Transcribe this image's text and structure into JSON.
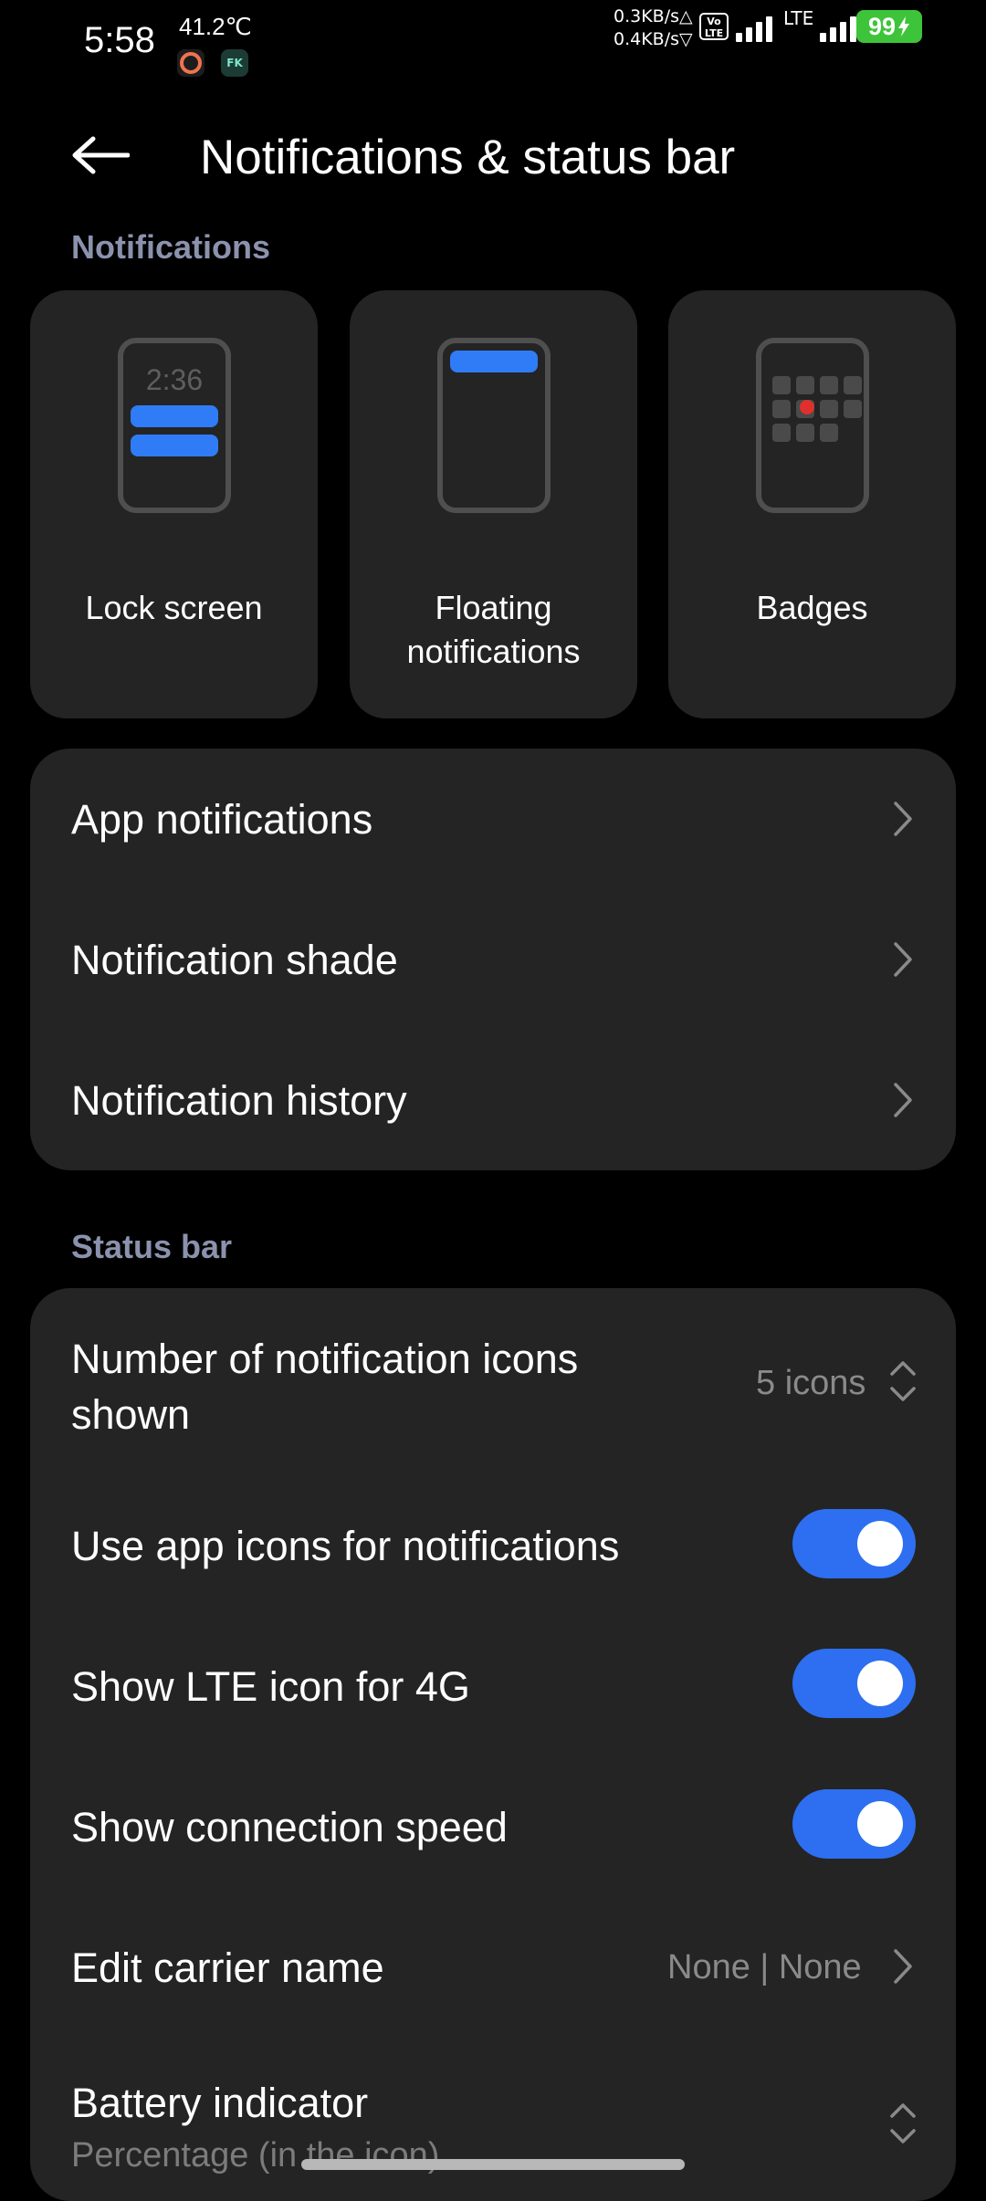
{
  "status_bar": {
    "time": "5:58",
    "temperature": "41.2℃",
    "speed_up": "0.3KB/s",
    "speed_down": "0.4KB/s",
    "volte_line1": "Vo",
    "volte_line2": "LTE",
    "network": "LTE",
    "battery": "99",
    "battery_color": "#3ec43a",
    "icons": [
      "ring-app-icon",
      "fk-app-icon",
      "signal-icon",
      "battery-charging-icon"
    ]
  },
  "header": {
    "title": "Notifications & status bar"
  },
  "notifications_section": {
    "label": "Notifications",
    "tiles": [
      {
        "label": "Lock screen",
        "preview_time": "2:36"
      },
      {
        "label_line1": "Floating",
        "label_line2": "notifications"
      },
      {
        "label": "Badges"
      }
    ],
    "items": [
      {
        "label": "App notifications"
      },
      {
        "label": "Notification shade"
      },
      {
        "label": "Notification history"
      }
    ]
  },
  "status_bar_section": {
    "label": "Status bar",
    "icon_count": {
      "label_line1": "Number of notification icons",
      "label_line2": "shown",
      "value": "5 icons"
    },
    "toggles": [
      {
        "label": "Use app icons for notifications",
        "on": true
      },
      {
        "label": "Show LTE icon for 4G",
        "on": true
      },
      {
        "label": "Show connection speed",
        "on": true
      }
    ],
    "carrier": {
      "label": "Edit carrier name",
      "value": "None | None"
    },
    "battery_indicator": {
      "label": "Battery indicator",
      "value": "Percentage (in the icon)"
    }
  },
  "colors": {
    "accent": "#2d6ff0",
    "section_label": "#8b92ad",
    "card_bg": "#242424",
    "badge_dot": "#e0302e"
  }
}
